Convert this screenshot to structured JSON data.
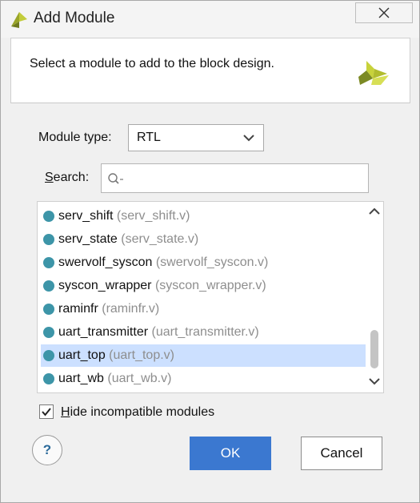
{
  "window": {
    "title": "Add Module",
    "accent_color": "#3b78d0"
  },
  "header": {
    "description": "Select a module to add to the block design."
  },
  "form": {
    "module_type_label": "Module type:",
    "module_type_value": "RTL",
    "search_label_prefix": "S",
    "search_label_rest": "earch:",
    "search_value": ""
  },
  "modules": [
    {
      "name": "serv_shift",
      "file": "(serv_shift.v)",
      "selected": false
    },
    {
      "name": "serv_state",
      "file": "(serv_state.v)",
      "selected": false
    },
    {
      "name": "swervolf_syscon",
      "file": "(swervolf_syscon.v)",
      "selected": false
    },
    {
      "name": "syscon_wrapper",
      "file": "(syscon_wrapper.v)",
      "selected": false
    },
    {
      "name": "raminfr",
      "file": "(raminfr.v)",
      "selected": false
    },
    {
      "name": "uart_transmitter",
      "file": "(uart_transmitter.v)",
      "selected": false
    },
    {
      "name": "uart_top",
      "file": "(uart_top.v)",
      "selected": true
    },
    {
      "name": "uart_wb",
      "file": "(uart_wb.v)",
      "selected": false
    }
  ],
  "options": {
    "hide_incompatible_prefix": "H",
    "hide_incompatible_rest": "ide incompatible modules",
    "hide_incompatible_checked": true
  },
  "buttons": {
    "help": "?",
    "ok": "OK",
    "cancel": "Cancel"
  }
}
